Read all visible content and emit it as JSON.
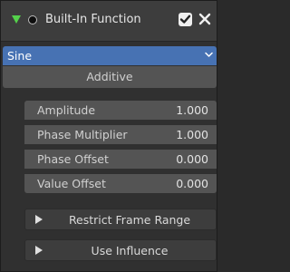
{
  "modifier": {
    "title": "Built-In Function",
    "enabled": true,
    "expand_icon": "triangle-down-icon",
    "toggle_icon": "dot-icon",
    "close_icon": "x-icon"
  },
  "function_dropdown": {
    "selected": "Sine"
  },
  "mode_button": {
    "label": "Additive"
  },
  "fields": [
    {
      "label": "Amplitude",
      "value": "1.000"
    },
    {
      "label": "Phase Multiplier",
      "value": "1.000"
    },
    {
      "label": "Phase Offset",
      "value": "0.000"
    },
    {
      "label": "Value Offset",
      "value": "0.000"
    }
  ],
  "subpanels": [
    {
      "label": "Restrict Frame Range"
    },
    {
      "label": "Use Influence"
    }
  ],
  "colors": {
    "accent_blue": "#4772b3",
    "expand_green": "#54d14b"
  }
}
